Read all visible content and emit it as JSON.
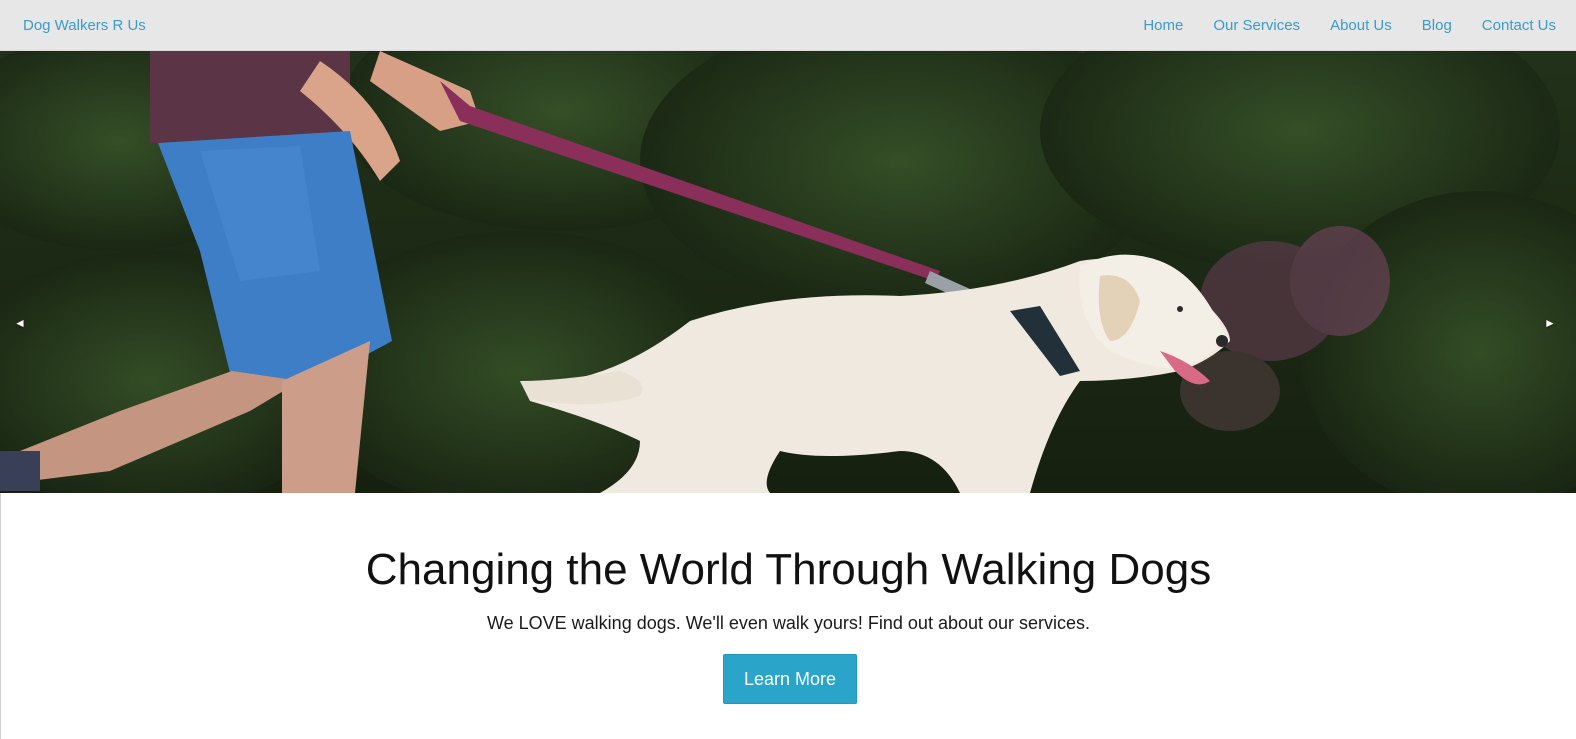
{
  "navbar": {
    "brand": "Dog Walkers R Us",
    "links": [
      {
        "label": "Home"
      },
      {
        "label": "Our Services"
      },
      {
        "label": "About Us"
      },
      {
        "label": "Blog"
      },
      {
        "label": "Contact Us"
      }
    ]
  },
  "hero": {
    "prev_arrow": "◄",
    "next_arrow": "►",
    "image": "photo of a person in blue shorts walking a white labrador on a purple leash in front of green hedges"
  },
  "content": {
    "headline": "Changing the World Through Walking Dogs",
    "subline": "We LOVE walking dogs. We'll even walk yours! Find out about our services.",
    "cta_label": "Learn More"
  },
  "colors": {
    "nav_bg": "#e7e7e7",
    "link": "#3a9cc8",
    "cta_bg": "#2aa5c9"
  }
}
